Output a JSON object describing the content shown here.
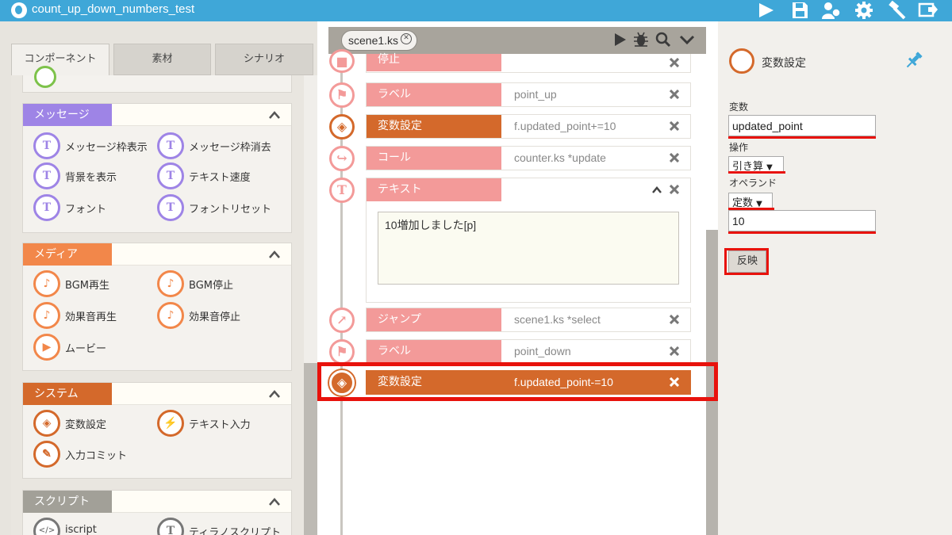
{
  "window": {
    "title": "count_up_down_numbers_test"
  },
  "toolbar": {
    "icons": [
      "play-icon",
      "save-icon",
      "users-icon",
      "gear-icon",
      "hammer-icon",
      "export-icon"
    ]
  },
  "left_panel": {
    "tabs": [
      {
        "label": "コンポーネント",
        "active": true
      },
      {
        "label": "素材",
        "active": false
      },
      {
        "label": "シナリオ",
        "active": false
      }
    ],
    "categories": [
      {
        "label": "メッセージ",
        "color": "#9e84e6",
        "items": [
          {
            "label": "メッセージ枠表示",
            "glyph": "T"
          },
          {
            "label": "メッセージ枠消去",
            "glyph": "T"
          },
          {
            "label": "背景を表示",
            "glyph": "T"
          },
          {
            "label": "テキスト速度",
            "glyph": "T"
          },
          {
            "label": "フォント",
            "glyph": "T"
          },
          {
            "label": "フォントリセット",
            "glyph": "T"
          }
        ]
      },
      {
        "label": "メディア",
        "color": "#f2874a",
        "items": [
          {
            "label": "BGM再生",
            "glyph": "♪"
          },
          {
            "label": "BGM停止",
            "glyph": "♪"
          },
          {
            "label": "効果音再生",
            "glyph": "♪"
          },
          {
            "label": "効果音停止",
            "glyph": "♪"
          },
          {
            "label": "ムービー",
            "glyph": "▶"
          }
        ]
      },
      {
        "label": "システム",
        "color": "#d4692b",
        "items": [
          {
            "label": "変数設定",
            "glyph": "◈"
          },
          {
            "label": "テキスト入力",
            "glyph": "⚡"
          },
          {
            "label": "入力コミット",
            "glyph": "✎"
          }
        ]
      },
      {
        "label": "スクリプト",
        "color": "#a2a098",
        "items": [
          {
            "label": "iscript",
            "glyph": "</>"
          },
          {
            "label": "ティラノスクリプト",
            "glyph": "T"
          }
        ]
      }
    ]
  },
  "scene": {
    "tab_label": "scene1.ks"
  },
  "timeline": {
    "rows": [
      {
        "name": "停止",
        "param": "",
        "icon": "stop-icon"
      },
      {
        "name": "ラベル",
        "param": "point_up",
        "icon": "flag-icon"
      },
      {
        "name": "変数設定",
        "param": "f.updated_point+=10",
        "icon": "variable-icon"
      },
      {
        "name": "コール",
        "param": "counter.ks *update",
        "icon": "call-icon"
      },
      {
        "name": "テキスト",
        "param": "",
        "icon": "text-icon"
      },
      {
        "name": "ジャンプ",
        "param": "scene1.ks *select",
        "icon": "jump-icon"
      },
      {
        "name": "ラベル",
        "param": "point_down",
        "icon": "flag-icon"
      },
      {
        "name": "変数設定",
        "param": "f.updated_point-=10",
        "icon": "variable-icon",
        "selected": true
      }
    ],
    "text_content": "10増加しました[p]",
    "text_icon_glyph": "T"
  },
  "properties": {
    "title": "変数設定",
    "variable_label": "変数",
    "variable_value": "updated_point",
    "operation_label": "操作",
    "operation_value": "引き算",
    "operand_label": "オペランド",
    "operand_type": "定数",
    "operand_value": "10",
    "apply_label": "反映"
  },
  "colors": {
    "accent": "#3fa7d8",
    "system_orange": "#d4692b",
    "pink": "#f39a99",
    "highlight_red": "#e8120c"
  }
}
